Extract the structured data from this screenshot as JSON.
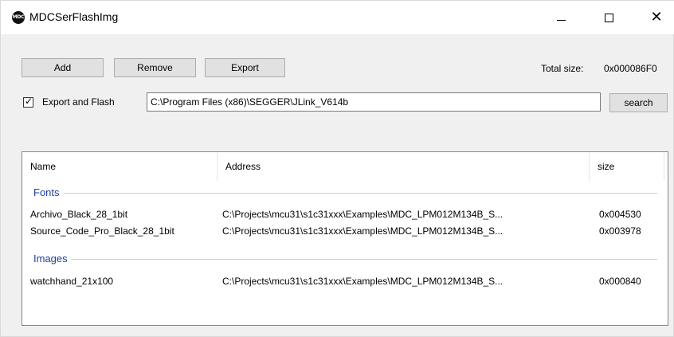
{
  "window": {
    "title": "MDCSerFlashImg",
    "app_icon_text": "MDC",
    "minimize_glyph": "",
    "close_glyph": "✕"
  },
  "toolbar": {
    "add_label": "Add",
    "remove_label": "Remove",
    "export_label": "Export",
    "total_size_label": "Total size:",
    "total_size_value": "0x000086F0"
  },
  "export_flash": {
    "checked": true,
    "checkmark": "✓",
    "label": "Export and Flash",
    "path_value": "C:\\Program Files (x86)\\SEGGER\\JLink_V614b",
    "search_label": "search"
  },
  "list": {
    "columns": [
      "Name",
      "Address",
      "size"
    ],
    "groups": [
      {
        "label": "Fonts",
        "items": [
          {
            "name": "Archivo_Black_28_1bit",
            "address": "C:\\Projects\\mcu31\\s1c31xxx\\Examples\\MDC_LPM012M134B_S...",
            "size": "0x004530"
          },
          {
            "name": "Source_Code_Pro_Black_28_1bit",
            "address": "C:\\Projects\\mcu31\\s1c31xxx\\Examples\\MDC_LPM012M134B_S...",
            "size": "0x003978"
          }
        ]
      },
      {
        "label": "Images",
        "items": [
          {
            "name": "watchhand_21x100",
            "address": "C:\\Projects\\mcu31\\s1c31xxx\\Examples\\MDC_LPM012M134B_S...",
            "size": "0x000840"
          }
        ]
      }
    ]
  },
  "colors": {
    "group_header": "#1e3f9c",
    "button_face": "#e1e1e1",
    "window_bg": "#f0f0f0"
  }
}
